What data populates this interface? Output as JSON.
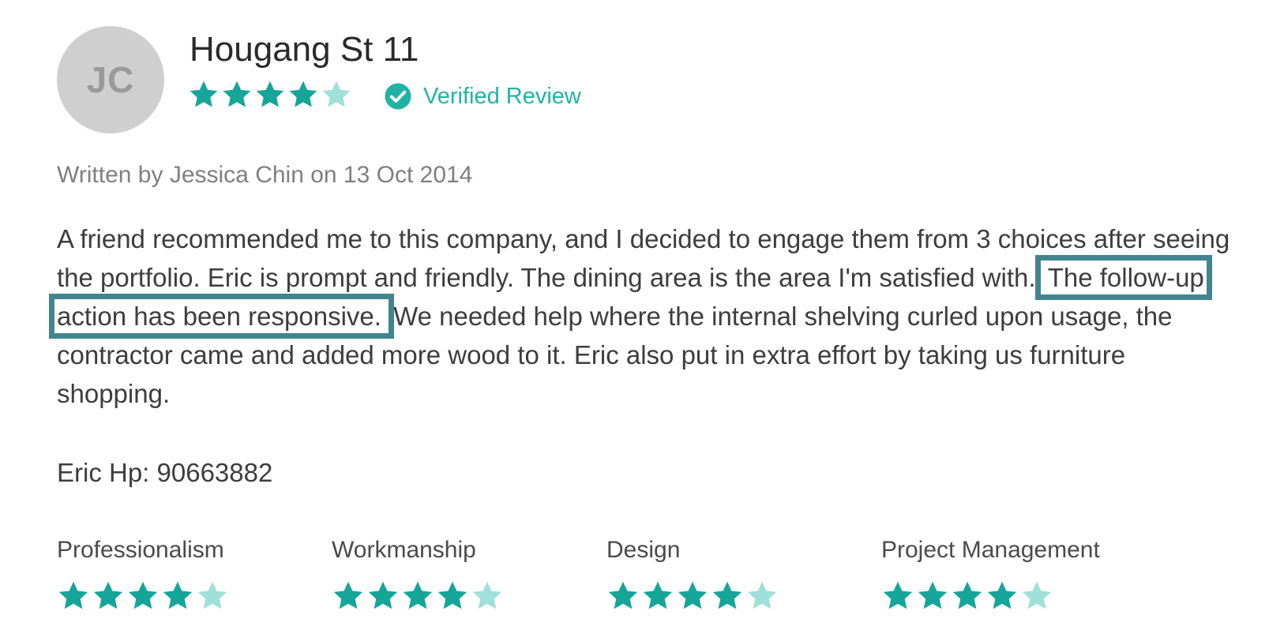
{
  "review": {
    "avatar_initials": "JC",
    "title": "Hougang St 11",
    "rating": 4,
    "rating_max": 5,
    "verified_label": "Verified Review",
    "written_line": "Written by Jessica Chin on 13 Oct 2014",
    "body_part1": "A friend recommended me to this company, and I decided to engage them from 3 choices after seeing the portfolio. Eric is prompt and friendly. The dining area is the area I'm satisfied with.",
    "body_highlight": "The follow-up action has been responsive.",
    "body_part2": "We needed help where the internal shelving curled upon usage, the contractor came and added more wood to it. Eric also put in extra effort by taking us furniture shopping.",
    "contact": "Eric Hp: 90663882"
  },
  "categories": [
    {
      "label": "Professionalism",
      "rating": 4
    },
    {
      "label": "Workmanship",
      "rating": 4
    },
    {
      "label": "Design",
      "rating": 4
    },
    {
      "label": "Project Management",
      "rating": 4
    }
  ],
  "colors": {
    "accent": "#15a599",
    "star_empty": "#9fe0d9",
    "highlight_border": "#41858e",
    "avatar_bg": "#cfcfcf"
  },
  "icons": {
    "star": "star-icon",
    "verified": "check-circle-icon"
  }
}
